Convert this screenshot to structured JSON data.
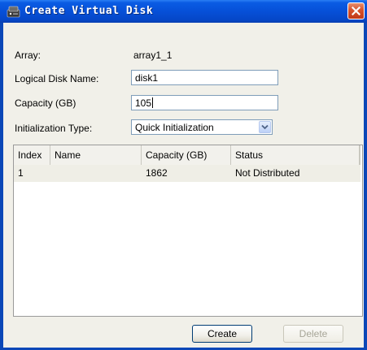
{
  "window": {
    "title": "Create Virtual Disk"
  },
  "form": {
    "array_label": "Array:",
    "array_value": "array1_1",
    "logical_disk_name_label": "Logical Disk Name:",
    "logical_disk_name_value": "disk1",
    "capacity_label": "Capacity (GB)",
    "capacity_value": "105",
    "init_type_label": "Initialization Type:",
    "init_type_value": "Quick Initialization"
  },
  "table": {
    "columns": [
      "Index",
      "Name",
      "Capacity (GB)",
      "Status"
    ],
    "rows": [
      {
        "index": "1",
        "name": "",
        "capacity": "1862",
        "status": "Not Distributed"
      }
    ]
  },
  "buttons": {
    "create": "Create",
    "delete": "Delete"
  },
  "colors": {
    "title_bar": "#0650d8",
    "close_button": "#d6512b",
    "dialog_bg": "#f1f0e9"
  }
}
